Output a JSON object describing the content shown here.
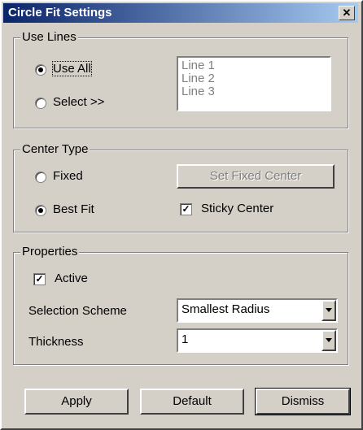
{
  "window": {
    "title": "Circle Fit Settings",
    "close_glyph": "✕"
  },
  "use_lines": {
    "legend": "Use Lines",
    "options": [
      {
        "label": "Use All",
        "selected": true
      },
      {
        "label": "Select >>",
        "selected": false
      }
    ],
    "lines": [
      "Line 1",
      "Line 2",
      "Line 3"
    ]
  },
  "center_type": {
    "legend": "Center Type",
    "options": [
      {
        "label": "Fixed",
        "selected": false
      },
      {
        "label": "Best Fit",
        "selected": true
      }
    ],
    "set_fixed_center_label": "Set Fixed Center",
    "sticky_center_label": "Sticky Center",
    "sticky_center_checked": true
  },
  "properties": {
    "legend": "Properties",
    "active_label": "Active",
    "active_checked": true,
    "selection_scheme_label": "Selection Scheme",
    "selection_scheme_value": "Smallest Radius",
    "thickness_label": "Thickness",
    "thickness_value": "1"
  },
  "footer": {
    "apply_label": "Apply",
    "default_label": "Default",
    "dismiss_label": "Dismiss"
  },
  "colors": {
    "title_bg": "#0a246a",
    "face": "#d4d0c8"
  }
}
